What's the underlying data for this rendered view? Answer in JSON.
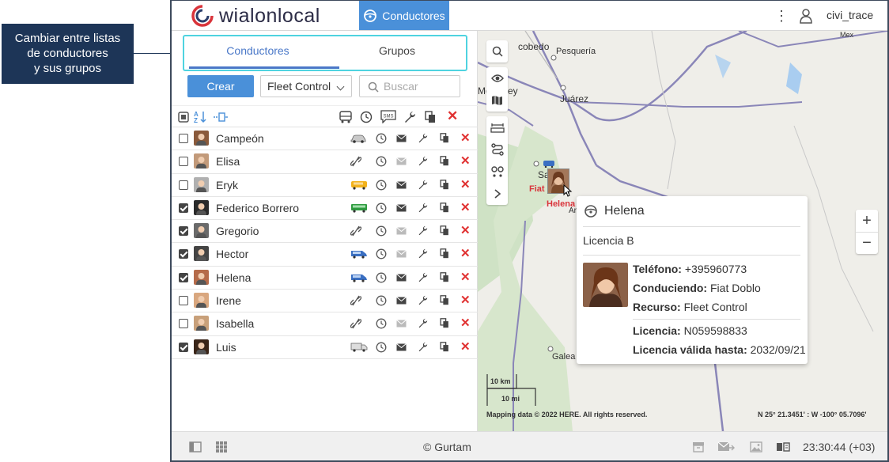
{
  "callout": {
    "line1": "Cambiar entre listas",
    "line2": "de conductores",
    "line3": "y sus grupos"
  },
  "header": {
    "logo_text": "wialonlocal",
    "nav_label": "Conductores",
    "username": "civi_trace"
  },
  "tabs": {
    "drivers": "Conductores",
    "groups": "Grupos"
  },
  "toolbar": {
    "create": "Crear",
    "resource": "Fleet Control",
    "search_placeholder": "Buscar"
  },
  "list_icons": {
    "sms": "SMS"
  },
  "drivers": [
    {
      "name": "Campeón",
      "checked": false,
      "vehicle": "car-icon"
    },
    {
      "name": "Elisa",
      "checked": false,
      "vehicle": "unbind-icon"
    },
    {
      "name": "Eryk",
      "checked": false,
      "vehicle": "bus-yellow-icon"
    },
    {
      "name": "Federico Borrero",
      "checked": true,
      "vehicle": "bus-green-icon"
    },
    {
      "name": "Gregorio",
      "checked": true,
      "vehicle": "unbind-icon"
    },
    {
      "name": "Hector",
      "checked": true,
      "vehicle": "van-icon"
    },
    {
      "name": "Helena",
      "checked": true,
      "vehicle": "van-icon"
    },
    {
      "name": "Irene",
      "checked": false,
      "vehicle": "unbind-icon"
    },
    {
      "name": "Isabella",
      "checked": false,
      "vehicle": "unbind-icon"
    },
    {
      "name": "Luis",
      "checked": true,
      "vehicle": "truck-icon"
    }
  ],
  "map": {
    "labels": {
      "escobedo": "cobedo",
      "pesqueria": "Pesquería",
      "monterrey": "Mo    rrey",
      "juarez": "Juárez",
      "saltillo": "Sa",
      "galeana": "Galea",
      "mexico": "Mex",
      "ar": "Ar"
    },
    "marker": {
      "vehicle": "Fiat",
      "driver": "Helena"
    },
    "scale_km": "10 km",
    "scale_mi": "10 mi",
    "copyright": "Mapping data © 2022 HERE. All rights reserved.",
    "coords": "N 25° 21.3451' : W -100° 05.7096'"
  },
  "popup": {
    "name": "Helena",
    "license_class": "Licencia B",
    "phone_label": "Teléfono:",
    "phone": "+395960773",
    "driving_label": "Conduciendo:",
    "driving": "Fiat Doblo",
    "resource_label": "Recurso:",
    "resource": "Fleet Control",
    "license_label": "Licencia:",
    "license": "N059598833",
    "valid_label": "Licencia válida hasta:",
    "valid": "2032/09/21"
  },
  "footer": {
    "copyright": "© Gurtam",
    "time": "23:30:44 (+03)"
  },
  "colors": {
    "accent": "#4a90d9",
    "delete": "#e03131",
    "tab_active": "#4a78c8",
    "callout_bg": "#1d3557"
  }
}
